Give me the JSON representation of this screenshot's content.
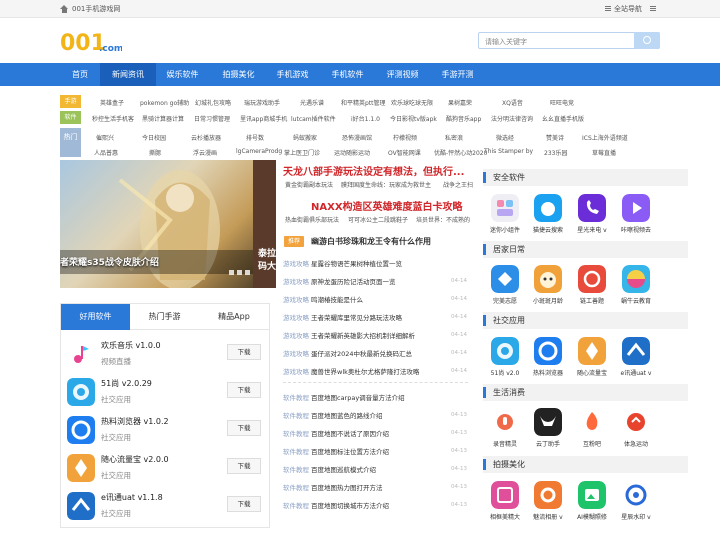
{
  "topbar": {
    "site_name": "001手机游戏网",
    "nav_label": "全站导航"
  },
  "search": {
    "placeholder": "请输入关键字"
  },
  "nav": {
    "items": [
      "首页",
      "新闻资讯",
      "娱乐软件",
      "拍摄美化",
      "手机游戏",
      "手机软件",
      "评测视频",
      "手游开测"
    ]
  },
  "links": {
    "tag_hot": "手游",
    "tag_soft": "软件",
    "tag_hotlist": "热门",
    "row1": [
      "英雄盒子",
      "pokemon go辅助",
      "幻城礼包攻略",
      "瑞玩游戏助手",
      "光遇乐谱",
      "和平精英ptt管理",
      "欢乐球吃球无限",
      "果树嘉荣",
      "XQ语音",
      "旺旺电竞"
    ],
    "row2": [
      "秒控生活手机客",
      "黑骑计算器计算",
      "日常习惯管理",
      "里讯app商城手机",
      "lutcam插件软件",
      "i好台1.1.0",
      "今日影视tv版apk",
      "酷狗音乐app",
      "法分明法律咨询",
      "幺幺直播手机版"
    ],
    "row3": [
      "催熙兴",
      "今日校园",
      "云杉播放器",
      "排号数",
      "蚂蚁搬家",
      "恐怖漫画馆",
      "柠檬视频",
      "私密浪",
      "微选经",
      "赞美诗",
      "ICS上海外语频道"
    ],
    "row4": [
      "人品普惠",
      "撕腮",
      "浮云漫画",
      "lgCameraProdg",
      "掌上医卫门诊",
      "运动随影运动",
      "OV智能网课",
      "优酷-怦然心动2020",
      "This Stamper by",
      "233乐园",
      "草莓直播"
    ]
  },
  "slider": {
    "caption": "者荣耀s35战令皮肤介绍",
    "next_caption": "泰拉\n码大"
  },
  "news": {
    "headline1": "天龙八部手游玩法设定有想法，但执行...",
    "sub1": [
      "黄金街霸副本玩法",
      "膜拜国度生命线：玩家成为救世主",
      "战争之王扫"
    ],
    "headline2": "NAXX构造区英雄难度蓝白卡攻略",
    "sub2": [
      "热血街霸俱乐部玩法",
      "可可冰公主二段跳鞋子",
      "培员世界：不成熟的"
    ],
    "tk_badge": "推荐",
    "tk_line": "幽游白书珍珠和龙王令有什么作用",
    "items1": [
      {
        "cat": "游戏攻略",
        "title": "星露谷物语芒果树种植位置一览",
        "date": ""
      },
      {
        "cat": "游戏攻略",
        "title": "原神龙蛋历险记活动页面一览",
        "date": "04-14"
      },
      {
        "cat": "游戏攻略",
        "title": "鸣潮椿技能是什么",
        "date": "04-14"
      },
      {
        "cat": "游戏攻略",
        "title": "王者荣耀库里常见分路玩法攻略",
        "date": "04-14"
      },
      {
        "cat": "游戏攻略",
        "title": "王者荣耀新英雄影大招机制详细解析",
        "date": "04-14"
      },
      {
        "cat": "游戏攻略",
        "title": "蛋仔派对2024中秋最新兑换码汇总",
        "date": "04-14"
      },
      {
        "cat": "游戏攻略",
        "title": "魔兽世界wlk奥杜尔尤格萨隆打法攻略",
        "date": "04-14"
      }
    ],
    "items2": [
      {
        "cat": "软件教程",
        "title": "百度地图carpay调音量方法介绍",
        "date": ""
      },
      {
        "cat": "软件教程",
        "title": "百度地图蓝色的路线介绍",
        "date": "04-13"
      },
      {
        "cat": "软件教程",
        "title": "百度地图不说话了原因介绍",
        "date": "04-13"
      },
      {
        "cat": "软件教程",
        "title": "百度地图标注位置方法介绍",
        "date": "04-13"
      },
      {
        "cat": "软件教程",
        "title": "百度地图巡航模式介绍",
        "date": "04-13"
      },
      {
        "cat": "软件教程",
        "title": "百度地图热力图打开方法",
        "date": "04-13"
      },
      {
        "cat": "软件教程",
        "title": "百度地图切换城市方法介绍",
        "date": "04-13"
      }
    ]
  },
  "tabs": {
    "labels": [
      "好用软件",
      "热门手游",
      "精品App"
    ],
    "download_label": "下载",
    "apps": [
      {
        "name": "欢乐音乐 v1.0.0",
        "cat": "视频直播",
        "color": "#ffffff"
      },
      {
        "name": "51尚 v2.0.29",
        "cat": "社交应用",
        "color": "#2aa8e8"
      },
      {
        "name": "热料浏览器 v1.0.2",
        "cat": "社交应用",
        "color": "#1e7ef0"
      },
      {
        "name": "随心流量宝 v2.0.0",
        "cat": "社交应用",
        "color": "#f2a23a"
      },
      {
        "name": "e讯通uat v1.1.8",
        "cat": "社交应用",
        "color": "#1f6fc8"
      }
    ]
  },
  "right": {
    "sections": [
      {
        "title": "安全软件",
        "items": [
          {
            "label": "迷你小组件",
            "color": "#f0f0f0"
          },
          {
            "label": "猫捷云搜索",
            "color": "#1aa1ef"
          },
          {
            "label": "星光来电 v",
            "color": "#6a2dd8"
          },
          {
            "label": "咔嚓视频去",
            "color": "#8b5bf5"
          }
        ]
      },
      {
        "title": "居家日常",
        "items": [
          {
            "label": "完美志愿",
            "color": "#2d8ee8"
          },
          {
            "label": "小斑斑月龄",
            "color": "#f1a13a"
          },
          {
            "label": "链工善题",
            "color": "#e84b3c"
          },
          {
            "label": "蜗牛云教育",
            "color": "#36b6e8"
          }
        ]
      },
      {
        "title": "社交应用",
        "items": [
          {
            "label": "51尚 v2.0",
            "color": "#2aa8e8"
          },
          {
            "label": "热料浏览器",
            "color": "#1e7ef0"
          },
          {
            "label": "随心流量宝",
            "color": "#f2a23a"
          },
          {
            "label": "e讯通uat v",
            "color": "#1f6fc8"
          }
        ]
      },
      {
        "title": "生活消费",
        "items": [
          {
            "label": "录音精灵",
            "color": "#ffffff"
          },
          {
            "label": "云丁助手",
            "color": "#222222"
          },
          {
            "label": "互粉吧",
            "color": "#ff6a3d"
          },
          {
            "label": "体急运动",
            "color": "#e8432d"
          }
        ]
      },
      {
        "title": "拍摄美化",
        "items": [
          {
            "label": "相框美精大",
            "color": "#e04f9a"
          },
          {
            "label": "魅流相册 v",
            "color": "#f07a32"
          },
          {
            "label": "AI模糊照修",
            "color": "#1fc36a"
          },
          {
            "label": "星辰水印 v",
            "color": "#2a6ad8"
          }
        ]
      }
    ]
  }
}
